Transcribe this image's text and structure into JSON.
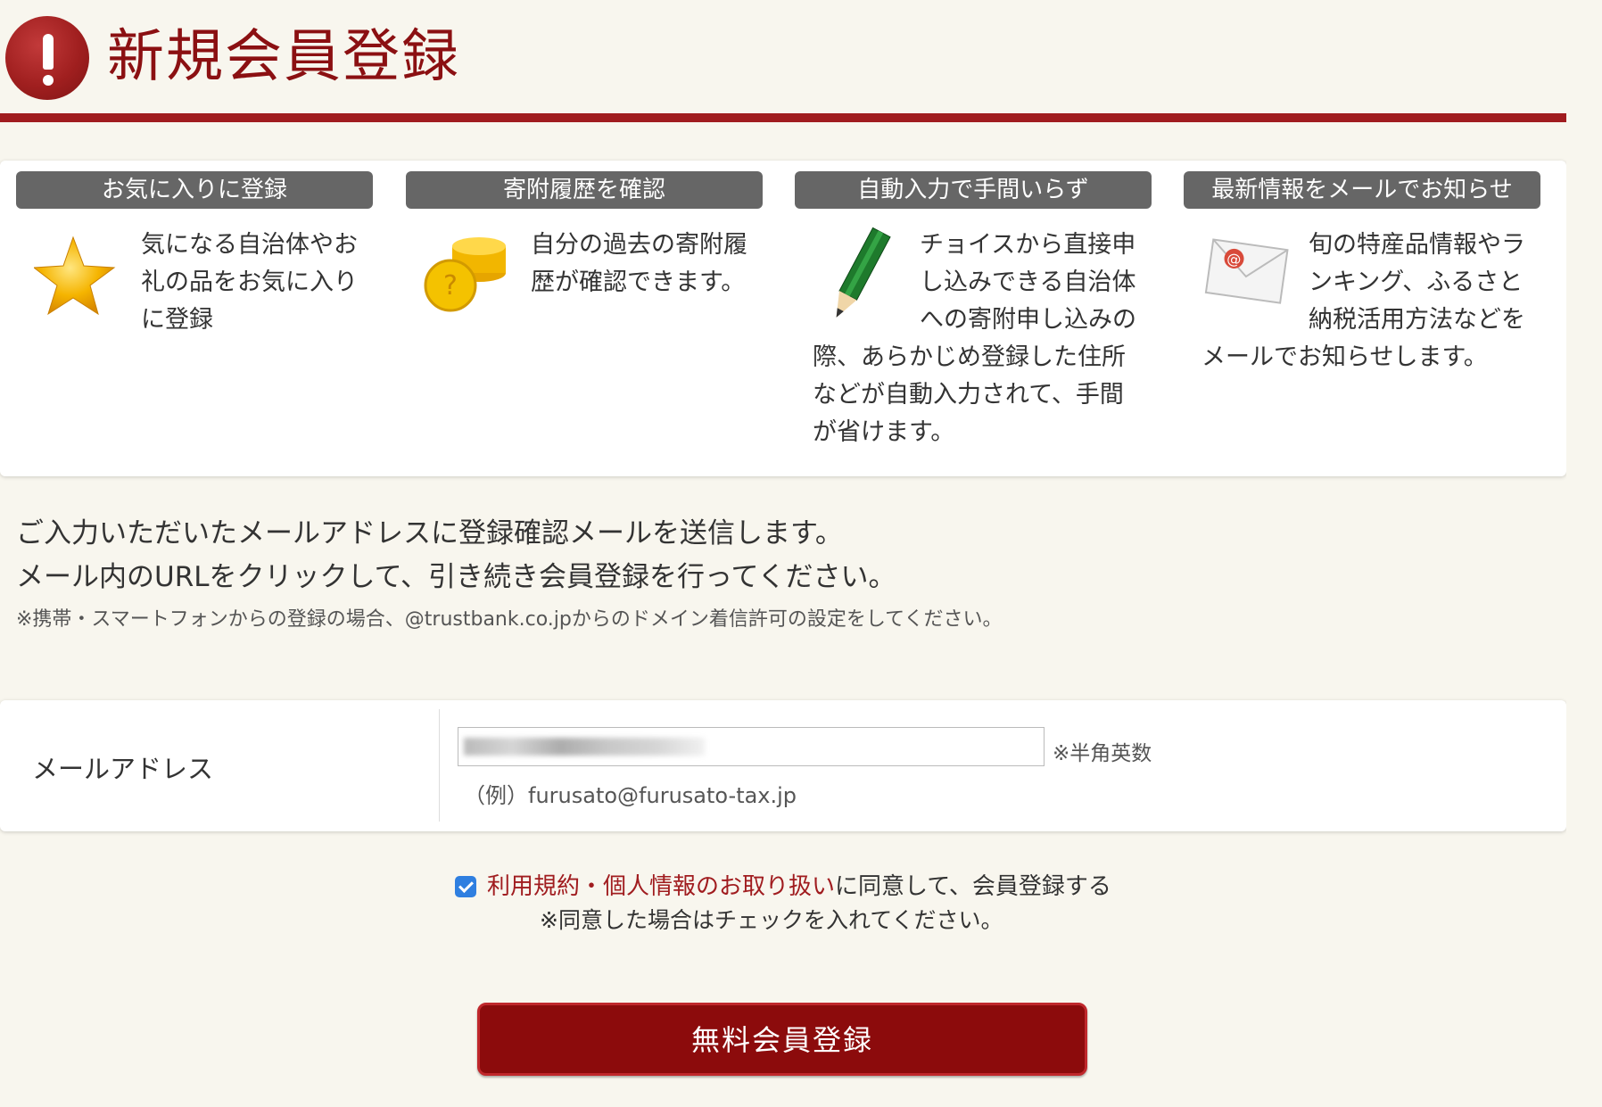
{
  "header": {
    "title": "新規会員登録"
  },
  "features": [
    {
      "heading": "お気に入りに登録",
      "icon": "star-icon",
      "description": "気になる自治体やお礼の品をお気に入りに登録"
    },
    {
      "heading": "寄附履歴を確認",
      "icon": "coins-icon",
      "description": "自分の過去の寄附履歴が確認できます。"
    },
    {
      "heading": "自動入力で手間いらず",
      "icon": "pencil-icon",
      "description": "チョイスから直接申し込みできる自治体への寄附申し込みの際、あらかじめ登録した住所などが自動入力されて、手間が省けます。"
    },
    {
      "heading": "最新情報をメールでお知らせ",
      "icon": "mail-icon",
      "description": "旬の特産品情報やランキング、ふるさと納税活用方法などをメールでお知らせします。"
    }
  ],
  "notice": {
    "line1": "ご入力いただいたメールアドレスに登録確認メールを送信します。",
    "line2": "メール内のURLをクリックして、引き続き会員登録を行ってください。",
    "small": "※携帯・スマートフォンからの登録の場合、@trustbank.co.jpからのドメイン着信許可の設定をしてください。"
  },
  "form": {
    "email_label": "メールアドレス",
    "email_note": "※半角英数",
    "email_example": "（例）furusato@furusato-tax.jp"
  },
  "agreement": {
    "checked": true,
    "link_text": "利用規約・個人情報のお取り扱い",
    "suffix": "に同意して、会員登録する",
    "note": "※同意した場合はチェックを入れてください。"
  },
  "submit": {
    "label": "無料会員登録"
  },
  "colors": {
    "brand_red": "#8c0b0c",
    "heading_bar": "#666666",
    "checkbox_blue": "#2f7fe0"
  }
}
